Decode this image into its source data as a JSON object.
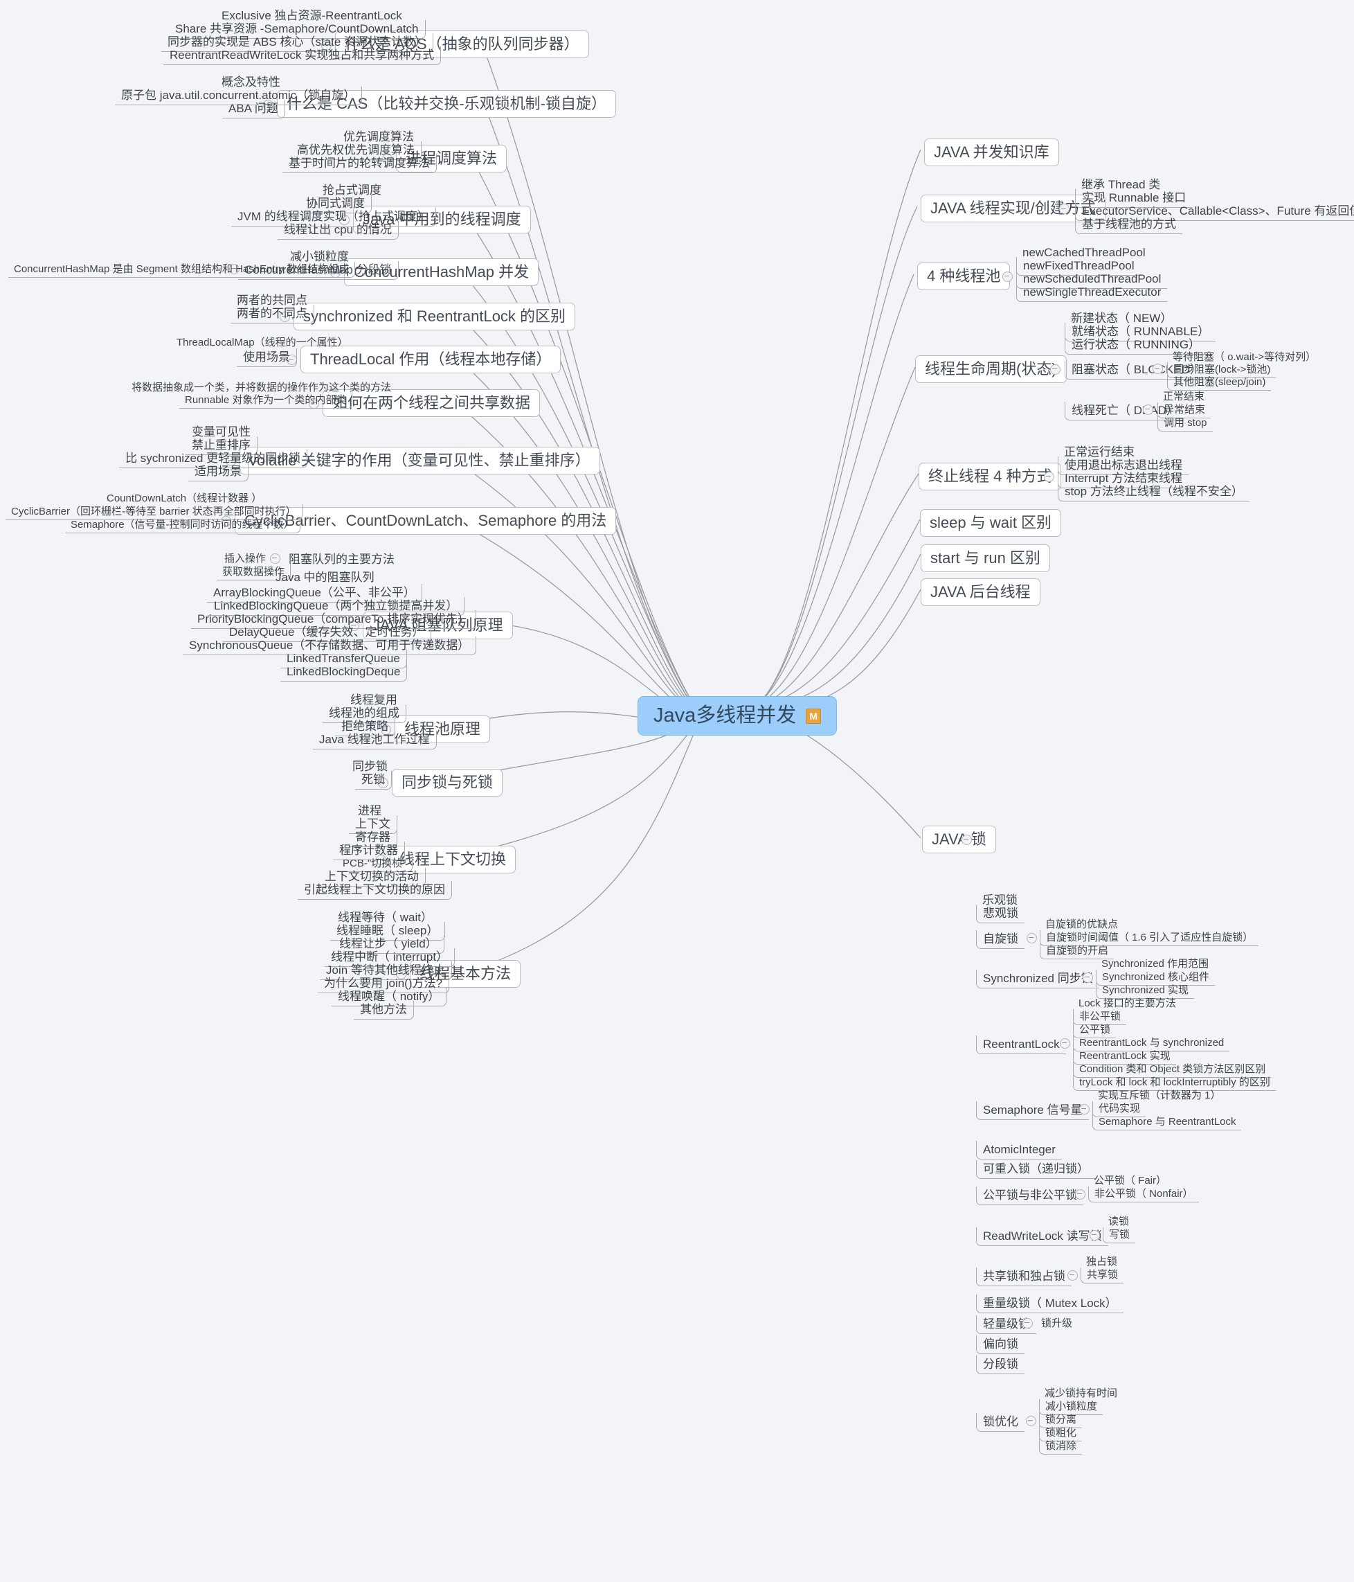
{
  "root": {
    "label": "Java多线程并发",
    "badge": "M",
    "color": "#9ccdfb"
  },
  "branches": {
    "aqs": {
      "label": "什么是 AQS（抽象的队列同步器）",
      "children": [
        "Exclusive 独占资源-ReentrantLock",
        "Share 共享资源 -Semaphore/CountDownLatch",
        "同步器的实现是 ABS 核心（state 资源状态计数）",
        "ReentrantReadWriteLock 实现独占和共享两种方式"
      ]
    },
    "cas": {
      "label": "什么是 CAS（比较并交换-乐观锁机制-锁自旋）",
      "children": [
        "概念及特性",
        "原子包 java.util.concurrent.atomic（锁自旋）",
        "ABA 问题"
      ]
    },
    "schedule_algo": {
      "label": "进程调度算法",
      "children": [
        "优先调度算法",
        "高优先权优先调度算法",
        "基于时间片的轮转调度算法"
      ]
    },
    "java_schedule": {
      "label": "Java 中用到的线程调度",
      "children": [
        "抢占式调度",
        "协同式调度",
        "JVM 的线程调度实现（抢占式调度）",
        "线程让出 cpu 的情况"
      ]
    },
    "chm": {
      "label": "ConcurrentHashMap 并发",
      "sub": "ConcurrentHashMap 分段锁",
      "sub_siblings": [
        "减小锁粒度"
      ],
      "leaf": "ConcurrentHashMap 是由 Segment 数组结构和 HashEntry 数组结构组成"
    },
    "sync_vs_reentrant": {
      "label": "synchronized 和 ReentrantLock 的区别",
      "children": [
        "两者的共同点",
        "两者的不同点"
      ]
    },
    "threadlocal": {
      "label": "ThreadLocal 作用（线程本地存储）",
      "children": [
        "ThreadLocalMap（线程的一个属性）",
        "使用场景"
      ]
    },
    "share_data": {
      "label": "如何在两个线程之间共享数据",
      "children": [
        "将数据抽象成一个类，并将数据的操作作为这个类的方法",
        "Runnable 对象作为一个类的内部类"
      ]
    },
    "volatile": {
      "label": "volatile 关键字的作用（变量可见性、禁止重排序）",
      "children": [
        "变量可见性",
        "禁止重排序",
        "比 sychronized 更轻量级的同步锁",
        "适用场景"
      ]
    },
    "concurrent_utils": {
      "label": "CyclicBarrier、CountDownLatch、Semaphore 的用法",
      "children": [
        "CountDownLatch（线程计数器 ）",
        "CyclicBarrier（回环栅栏-等待至 barrier 状态再全部同时执行）",
        "Semaphore（信号量-控制同时访问的线程个数）"
      ]
    },
    "blocking_queue": {
      "label": "JAVA 阻塞队列原理",
      "methods_node": "阻塞队列的主要方法",
      "methods_children": [
        "插入操作",
        "获取数据操作"
      ],
      "children": [
        "Java 中的阻塞队列",
        "ArrayBlockingQueue（公平、非公平）",
        "LinkedBlockingQueue（两个独立锁提高并发）",
        "PriorityBlockingQueue（compareTo 排序实现优先）",
        "DelayQueue（缓存失效、定时任务）",
        "SynchronousQueue（不存储数据、可用于传递数据）",
        "LinkedTransferQueue",
        "LinkedBlockingDeque"
      ]
    },
    "thread_pool": {
      "label": "线程池原理",
      "children": [
        "线程复用",
        "线程池的组成",
        "拒绝策略",
        "Java 线程池工作过程"
      ]
    },
    "sync_deadlock": {
      "label": "同步锁与死锁",
      "children": [
        "同步锁",
        "死锁"
      ]
    },
    "context_switch": {
      "label": "线程上下文切换",
      "children": [
        "进程",
        "上下文",
        "寄存器",
        "程序计数器",
        "PCB-\"切换桢\"",
        "上下文切换的活动",
        "引起线程上下文切换的原因"
      ]
    },
    "basic_methods": {
      "label": "线程基本方法",
      "children": [
        "线程等待（ wait）",
        "线程睡眠（ sleep）",
        "线程让步（ yield）",
        "线程中断（ interrupt）",
        "Join 等待其他线程终止",
        "为什么要用 join()方法?",
        "线程唤醒（ notify）",
        "其他方法"
      ]
    },
    "kb": {
      "label": "JAVA 并发知识库"
    },
    "thread_create": {
      "label": "JAVA 线程实现/创建方式",
      "children": [
        "继承 Thread 类",
        "实现 Runnable 接口",
        "ExecutorService、Callable<Class>、Future 有返回值线程",
        "基于线程池的方式"
      ]
    },
    "four_pools": {
      "label": "4 种线程池",
      "children": [
        "newCachedThreadPool",
        "newFixedThreadPool",
        "newScheduledThreadPool",
        "newSingleThreadExecutor"
      ]
    },
    "lifecycle": {
      "label": "线程生命周期(状态)",
      "children": [
        "新建状态（ NEW）",
        "就绪状态（ RUNNABLE）",
        "运行状态（ RUNNING）",
        "阻塞状态（ BLOCKED）",
        "线程死亡（ DEAD）"
      ],
      "blocked_children": [
        "等待阻塞（ o.wait->等待对列）",
        "同步阻塞(lock->锁池)",
        "其他阻塞(sleep/join)"
      ],
      "dead_children": [
        "正常结束",
        "异常结束",
        "调用 stop"
      ]
    },
    "terminate": {
      "label": "终止线程 4 种方式",
      "children": [
        "正常运行结束",
        "使用退出标志退出线程",
        "Interrupt 方法结束线程",
        "stop 方法终止线程（线程不安全）"
      ]
    },
    "sleep_wait": {
      "label": "sleep 与 wait 区别"
    },
    "start_run": {
      "label": "start 与 run 区别"
    },
    "daemon": {
      "label": "JAVA 后台线程"
    },
    "java_lock": {
      "label": "JAVA 锁",
      "children": [
        "乐观锁",
        "悲观锁",
        "自旋锁",
        "Synchronized 同步锁",
        "ReentrantLock",
        "Semaphore 信号量",
        "AtomicInteger",
        "可重入锁（递归锁）",
        "公平锁与非公平锁",
        "ReadWriteLock 读写锁",
        "共享锁和独占锁",
        "重量级锁（ Mutex Lock）",
        "轻量级锁",
        "偏向锁",
        "分段锁",
        "锁优化"
      ],
      "spin_children": [
        "自旋锁的优缺点",
        "自旋锁时间阈值（ 1.6 引入了适应性自旋锁）",
        "自旋锁的开启"
      ],
      "sync_children": [
        "Synchronized 作用范围",
        "Synchronized 核心组件",
        "Synchronized 实现"
      ],
      "reentrant_children": [
        "Lock 接口的主要方法",
        "非公平锁",
        "公平锁",
        "ReentrantLock 与 synchronized",
        "ReentrantLock 实现",
        "Condition 类和 Object 类锁方法区别区别",
        "tryLock 和 lock 和 lockInterruptibly 的区别"
      ],
      "semaphore_children": [
        "实现互斥锁（计数器为 1）",
        "代码实现",
        "Semaphore 与 ReentrantLock"
      ],
      "fair_children": [
        "公平锁（ Fair）",
        "非公平锁（ Nonfair）"
      ],
      "rwlock_children": [
        "读锁",
        "写锁"
      ],
      "sharedex_children": [
        "独占锁",
        "共享锁"
      ],
      "light_children": [
        "锁升级"
      ],
      "opt_children": [
        "减少锁持有时间",
        "减小锁粒度",
        "锁分离",
        "锁粗化",
        "锁消除"
      ]
    }
  }
}
